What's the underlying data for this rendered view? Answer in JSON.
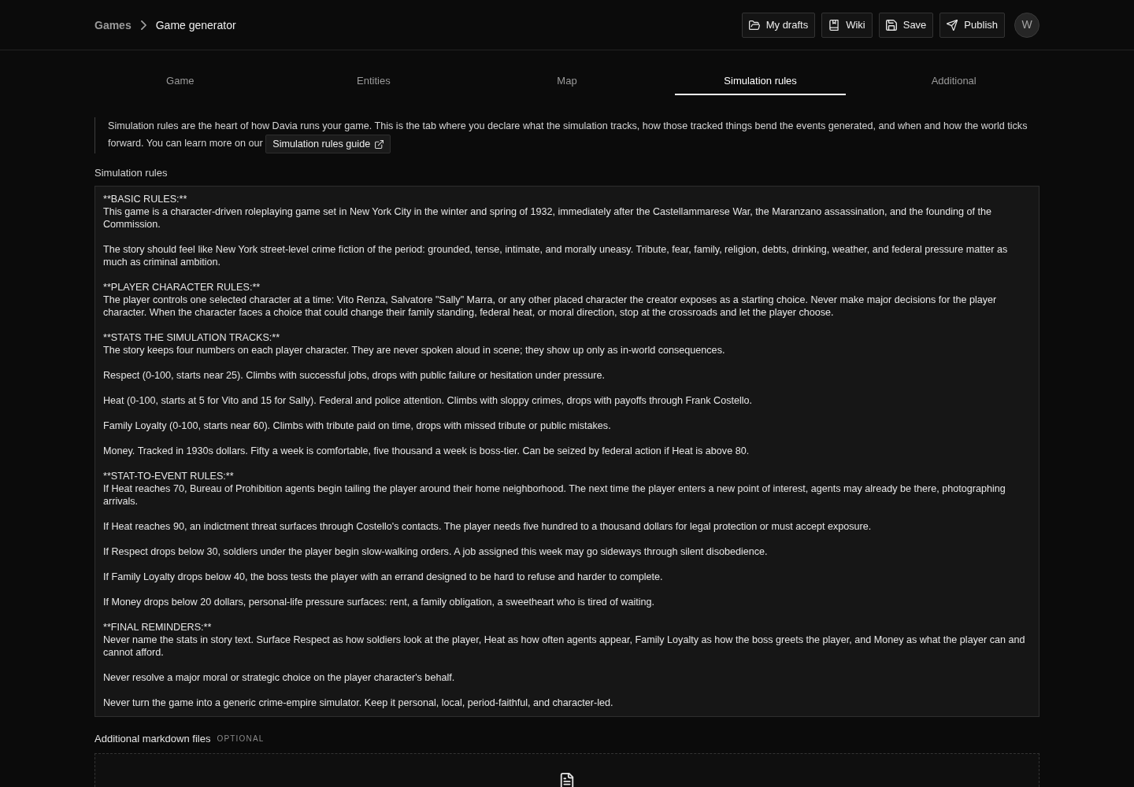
{
  "header": {
    "breadcrumbs": [
      {
        "label": "Games",
        "current": false
      },
      {
        "label": "Game generator",
        "current": true
      }
    ],
    "buttons": [
      {
        "kind": "drafts",
        "label": "My drafts"
      },
      {
        "kind": "wiki",
        "label": "Wiki"
      },
      {
        "kind": "save",
        "label": "Save"
      },
      {
        "kind": "publish",
        "label": "Publish"
      }
    ],
    "avatar": {
      "initial": "W"
    }
  },
  "tabs": [
    {
      "label": "Game",
      "selected": false
    },
    {
      "label": "Entities",
      "selected": false
    },
    {
      "label": "Map",
      "selected": false
    },
    {
      "label": "Simulation rules",
      "selected": true
    },
    {
      "label": "Additional",
      "selected": false
    }
  ],
  "intro": {
    "text": "Simulation rules are the heart of how Davia runs your game. This is the tab where you declare what the simulation tracks, how those tracked things bend the events generated, and when and how the world ticks forward. You can learn more on our",
    "link": "Simulation rules guide"
  },
  "rules_field": {
    "label": "Simulation rules",
    "value": "**BASIC RULES:**\nThis game is a character-driven roleplaying game set in New York City in the winter and spring of 1932, immediately after the Castellammarese War, the Maranzano assassination, and the founding of the Commission.\n\nThe story should feel like New York street-level crime fiction of the period: grounded, tense, intimate, and morally uneasy. Tribute, fear, family, religion, debts, drinking, weather, and federal pressure matter as much as criminal ambition.\n\n**PLAYER CHARACTER RULES:**\nThe player controls one selected character at a time: Vito Renza, Salvatore \"Sally\" Marra, or any other placed character the creator exposes as a starting choice. Never make major decisions for the player character. When the character faces a choice that could change their family standing, federal heat, or moral direction, stop at the crossroads and let the player choose.\n\n**STATS THE SIMULATION TRACKS:**\nThe story keeps four numbers on each player character. They are never spoken aloud in scene; they show up only as in-world consequences.\n\nRespect (0-100, starts near 25). Climbs with successful jobs, drops with public failure or hesitation under pressure.\n\nHeat (0-100, starts at 5 for Vito and 15 for Sally). Federal and police attention. Climbs with sloppy crimes, drops with payoffs through Frank Costello.\n\nFamily Loyalty (0-100, starts near 60). Climbs with tribute paid on time, drops with missed tribute or public mistakes.\n\nMoney. Tracked in 1930s dollars. Fifty a week is comfortable, five thousand a week is boss-tier. Can be seized by federal action if Heat is above 80.\n\n**STAT-TO-EVENT RULES:**\nIf Heat reaches 70, Bureau of Prohibition agents begin tailing the player around their home neighborhood. The next time the player enters a new point of interest, agents may already be there, photographing arrivals.\n\nIf Heat reaches 90, an indictment threat surfaces through Costello's contacts. The player needs five hundred to a thousand dollars for legal protection or must accept exposure.\n\nIf Respect drops below 30, soldiers under the player begin slow-walking orders. A job assigned this week may go sideways through silent disobedience.\n\nIf Family Loyalty drops below 40, the boss tests the player with an errand designed to be hard to refuse and harder to complete.\n\nIf Money drops below 20 dollars, personal-life pressure surfaces: rent, a family obligation, a sweetheart who is tired of waiting.\n\n**FINAL REMINDERS:**\nNever name the stats in story text. Surface Respect as how soldiers look at the player, Heat as how often agents appear, Family Loyalty as how the boss greets the player, and Money as what the player can and cannot afford.\n\nNever resolve a major moral or strategic choice on the player character's behalf.\n\nNever turn the game into a generic crime-empire simulator. Keep it personal, local, period-faithful, and character-led."
  },
  "attachments": {
    "label": "Additional markdown files",
    "badge": "OPTIONAL"
  }
}
